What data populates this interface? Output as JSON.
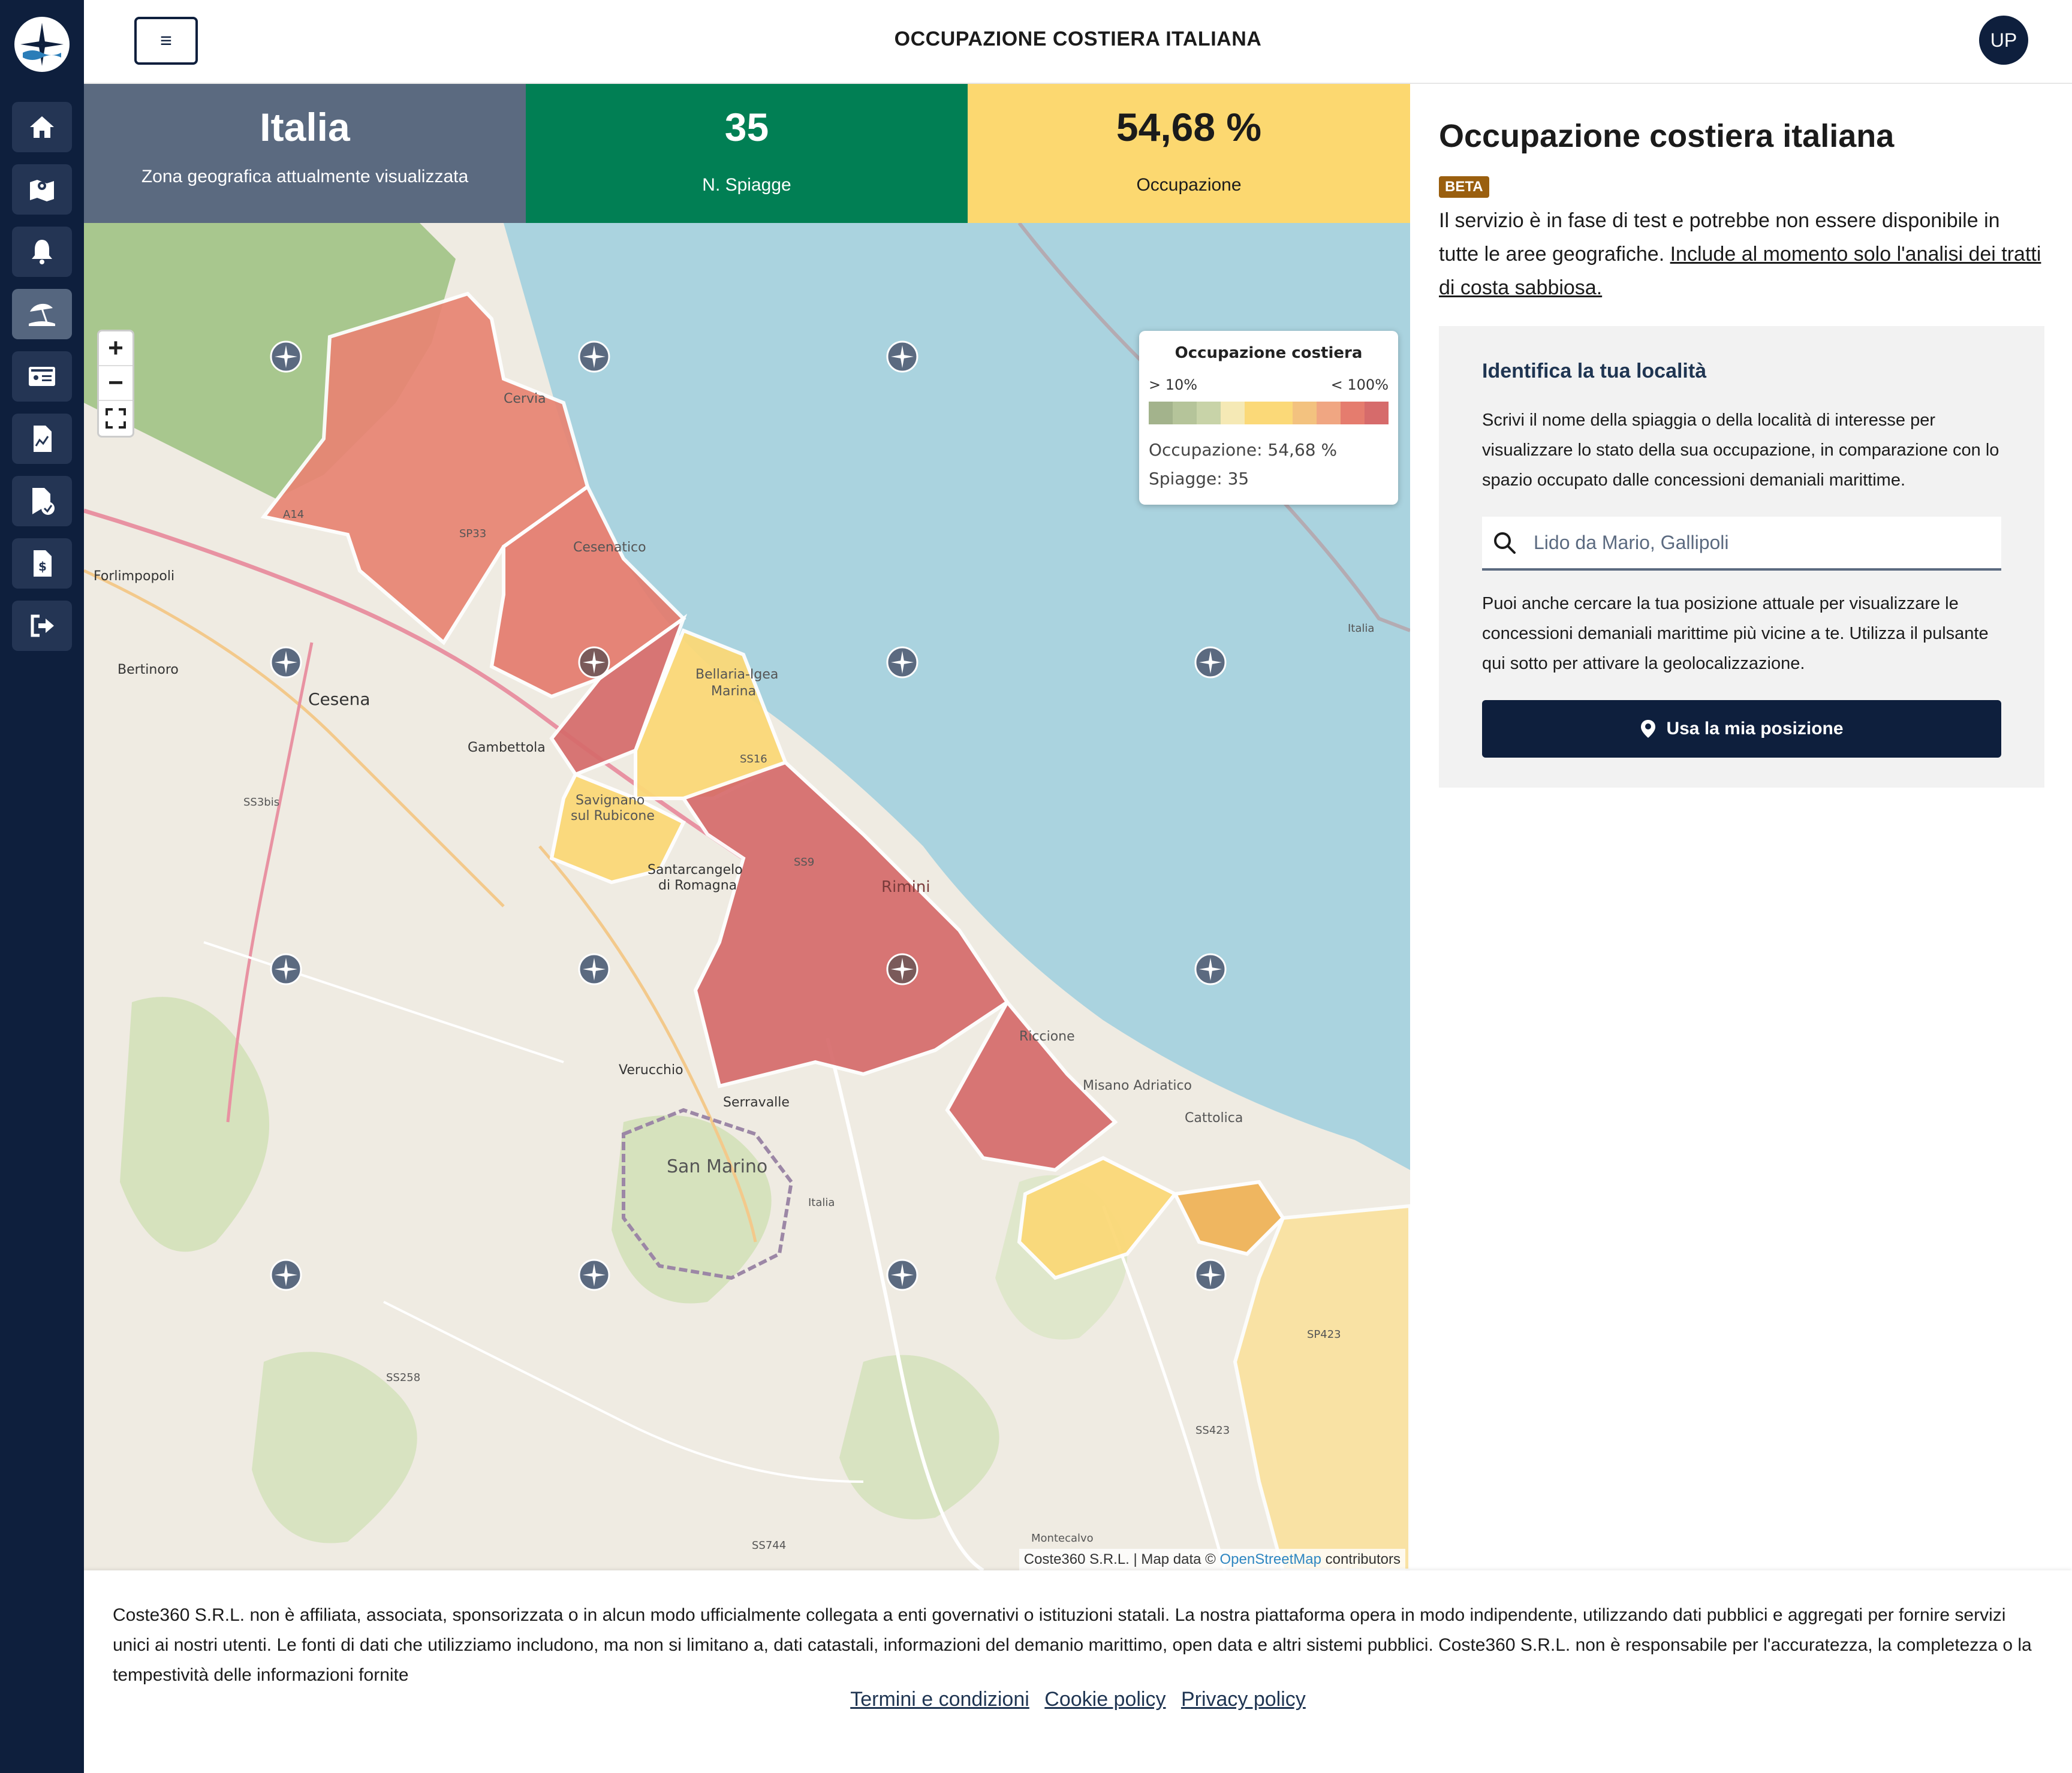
{
  "app": {
    "title": "OCCUPAZIONE COSTIERA ITALIANA",
    "avatar_initials": "UP"
  },
  "sidebar": {
    "items": [
      {
        "icon": "home-icon"
      },
      {
        "icon": "map-icon"
      },
      {
        "icon": "bell-icon"
      },
      {
        "icon": "beach-umbrella-icon",
        "active": true
      },
      {
        "icon": "id-card-icon"
      },
      {
        "icon": "document-chart-icon"
      },
      {
        "icon": "document-check-icon"
      },
      {
        "icon": "invoice-dollar-icon"
      },
      {
        "icon": "logout-icon"
      }
    ]
  },
  "stats": {
    "zone": {
      "value": "Italia",
      "label": "Zona geografica attualmente visualizzata",
      "color": "#5b6a80"
    },
    "beaches": {
      "value": "35",
      "label": "N. Spiagge",
      "color": "#017f54"
    },
    "occupancy": {
      "value": "54,68 %",
      "label": "Occupazione",
      "color": "#fcd870"
    }
  },
  "map": {
    "legend": {
      "title": "Occupazione costiera",
      "min_label": "> 10%",
      "max_label": "< 100%",
      "scale_colors": [
        "#a3b38c",
        "#b5c49a",
        "#c8d3a8",
        "#f5e9b5",
        "#fbd978",
        "#fbd978",
        "#f3c27f",
        "#f0a682",
        "#e57c6e",
        "#d66b6b"
      ],
      "occupancy_text": "Occupazione: 54,68 %",
      "beaches_text": "Spiagge: 35"
    },
    "zoom_in": "+",
    "zoom_out": "−",
    "attribution_prefix": "Coste360 S.R.L. | Map data ©",
    "attribution_link": "OpenStreetMap",
    "attribution_suffix": "contributors",
    "place_labels": [
      "Cervia",
      "Cesenatico",
      "Bellaria-Igea Marina",
      "Savignano sul Rubicone",
      "Santarcangelo di Romagna",
      "Rimini",
      "Riccione",
      "Misano Adriatico",
      "Cattolica",
      "Forlimpopoli",
      "Bertinoro",
      "Cesena",
      "Gambettola",
      "Verucchio",
      "Serravalle",
      "San Marino",
      "Montecalvo"
    ],
    "road_labels": [
      "A14",
      "SP33",
      "SS3bis",
      "SS16",
      "SS9",
      "SS258",
      "SS423",
      "SP423",
      "SS744",
      "Italia"
    ]
  },
  "panel": {
    "title": "Occupazione costiera italiana",
    "badge": "BETA",
    "desc": "Il servizio è in fase di test e potrebbe non essere disponibile in tutte le aree geografiche.",
    "desc_link": "Include al momento solo l'analisi dei tratti di costa sabbiosa.",
    "locate": {
      "title": "Identifica la tua località",
      "desc": "Scrivi il nome della spiaggia o della località di interesse per visualizzare lo stato della sua occupazione, in comparazione con lo spazio occupato dalle concessioni demaniali marittime.",
      "search_placeholder": "Lido da Mario, Gallipoli",
      "desc2": "Puoi anche cercare la tua posizione attuale per visualizzare le concessioni demaniali marittime più vicine a te. Utilizza il pulsante qui sotto per attivare la geolocalizzazione.",
      "button_label": "Usa la mia posizione"
    }
  },
  "footer": {
    "disclaimer": "Coste360 S.R.L. non è affiliata, associata, sponsorizzata o in alcun modo ufficialmente collegata a enti governativi o istituzioni statali. La nostra piattaforma opera in modo indipendente, utilizzando dati pubblici e aggregati per fornire servizi unici ai nostri utenti. Le fonti di dati che utilizziamo includono, ma non si limitano a, dati catastali, informazioni del demanio marittimo, open data e altri sistemi pubblici. Coste360 S.R.L. non è responsabile per l'accuratezza, la completezza o la tempestività delle informazioni fornite",
    "links": [
      "Termini e condizioni",
      "Cookie policy",
      "Privacy policy"
    ]
  }
}
